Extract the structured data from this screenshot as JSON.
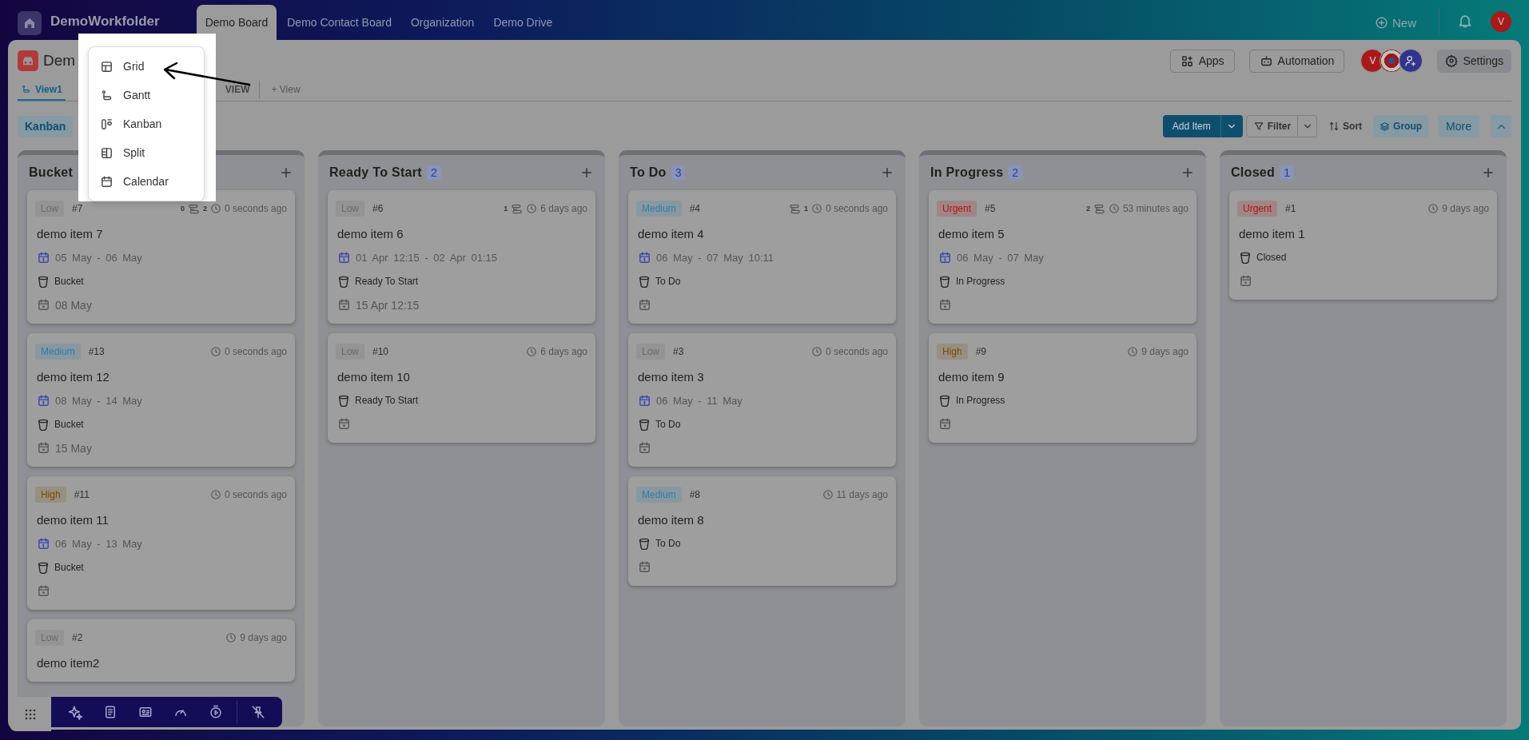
{
  "top_bar": {
    "workspace": "DemoWorkfolder",
    "tabs": [
      {
        "label": "Demo Board",
        "selected": true
      },
      {
        "label": "Demo Contact Board",
        "selected": false
      },
      {
        "label": "Organization",
        "selected": false
      },
      {
        "label": "Demo Drive",
        "selected": false
      }
    ],
    "new_button": "New",
    "avatar": "V"
  },
  "board": {
    "title": "Dem",
    "view_tabs": [
      {
        "label": "View1",
        "selected": true,
        "kind": "view"
      },
      {
        "label": "VIEW",
        "selected": false,
        "kind": "plain"
      }
    ],
    "add_view_button": "+ View",
    "layout_chip": "Kanban",
    "apps_button": "Apps",
    "automation_button": "Automation",
    "settings_button": "Settings",
    "members": [
      {
        "kind": "letter",
        "initial": "V"
      },
      {
        "kind": "photo"
      },
      {
        "kind": "invite"
      }
    ],
    "add_item_button": "Add Item",
    "filter_button": "Filter",
    "sort_button": "Sort",
    "group_button": "Group",
    "more_button": "More"
  },
  "view_menu": {
    "items": [
      {
        "label": "Grid",
        "kind": "grid"
      },
      {
        "label": "Gantt",
        "kind": "gantt"
      },
      {
        "label": "Kanban",
        "kind": "kanban"
      },
      {
        "label": "Split",
        "kind": "split"
      },
      {
        "label": "Calendar",
        "kind": "calendar"
      }
    ]
  },
  "columns": [
    {
      "title": "Bucket",
      "cards": [
        {
          "priority": "Low",
          "color": "#6b6b6b",
          "number": "#7",
          "subtasks_before": "0",
          "subtasks_after": "2",
          "updated": "0 seconds ago",
          "title": "demo item 7",
          "dates": "05 May - 06 May",
          "status": "Bucket",
          "due": "08 May"
        },
        {
          "priority": "Medium",
          "color": "#2a7fad",
          "number": "#13",
          "updated": "0 seconds ago",
          "title": "demo item 12",
          "dates": "08 May - 14 May",
          "status": "Bucket",
          "due": "15 May"
        },
        {
          "priority": "High",
          "color": "#7a4c00",
          "number": "#11",
          "updated": "0 seconds ago",
          "title": "demo item 11",
          "dates": "06 May - 13 May",
          "status": "Bucket"
        },
        {
          "priority": "Low",
          "color": "#6b6b6b",
          "number": "#2",
          "updated": "9 days ago",
          "title": "demo item2"
        }
      ]
    },
    {
      "title": "Ready To Start",
      "count": "2",
      "cards": [
        {
          "priority": "Low",
          "color": "#6b6b6b",
          "number": "#6",
          "subtasks_before": "1",
          "updated": "6 days ago",
          "title": "demo item 6",
          "dates": "01 Apr 12:15 - 02 Apr 01:15",
          "status": "Ready To Start",
          "due": "15 Apr 12:15"
        },
        {
          "priority": "Low",
          "color": "#6b6b6b",
          "number": "#10",
          "updated": "6 days ago",
          "title": "demo item 10",
          "status": "Ready To Start"
        }
      ]
    },
    {
      "title": "To Do",
      "count": "3",
      "cards": [
        {
          "priority": "Medium",
          "color": "#2a7fad",
          "number": "#4",
          "subtasks_after": "1",
          "updated": "0 seconds ago",
          "title": "demo item 4",
          "dates": "06 May - 07 May 10:11",
          "status": "To Do"
        },
        {
          "priority": "Low",
          "color": "#6b6b6b",
          "number": "#3",
          "updated": "0 seconds ago",
          "title": "demo item 3",
          "dates": "06 May - 11 May",
          "status": "To Do"
        },
        {
          "priority": "Medium",
          "color": "#2a7fad",
          "number": "#8",
          "updated": "11 days ago",
          "title": "demo item 8",
          "status": "To Do"
        }
      ]
    },
    {
      "title": "In Progress",
      "count": "2",
      "cards": [
        {
          "priority": "Urgent",
          "color": "#b01515",
          "number": "#5",
          "subtasks_before": "2",
          "updated": "53 minutes ago",
          "title": "demo item 5",
          "dates": "06 May - 07 May",
          "status": "In Progress"
        },
        {
          "priority": "High",
          "color": "#7a4c00",
          "number": "#9",
          "updated": "9 days ago",
          "title": "demo item 9",
          "status": "In Progress"
        }
      ]
    },
    {
      "title": "Closed",
      "count": "1",
      "cards": [
        {
          "priority": "Urgent",
          "color": "#b01515",
          "number": "#1",
          "updated": "9 days ago",
          "title": "demo item 1",
          "status": "Closed"
        }
      ]
    }
  ]
}
